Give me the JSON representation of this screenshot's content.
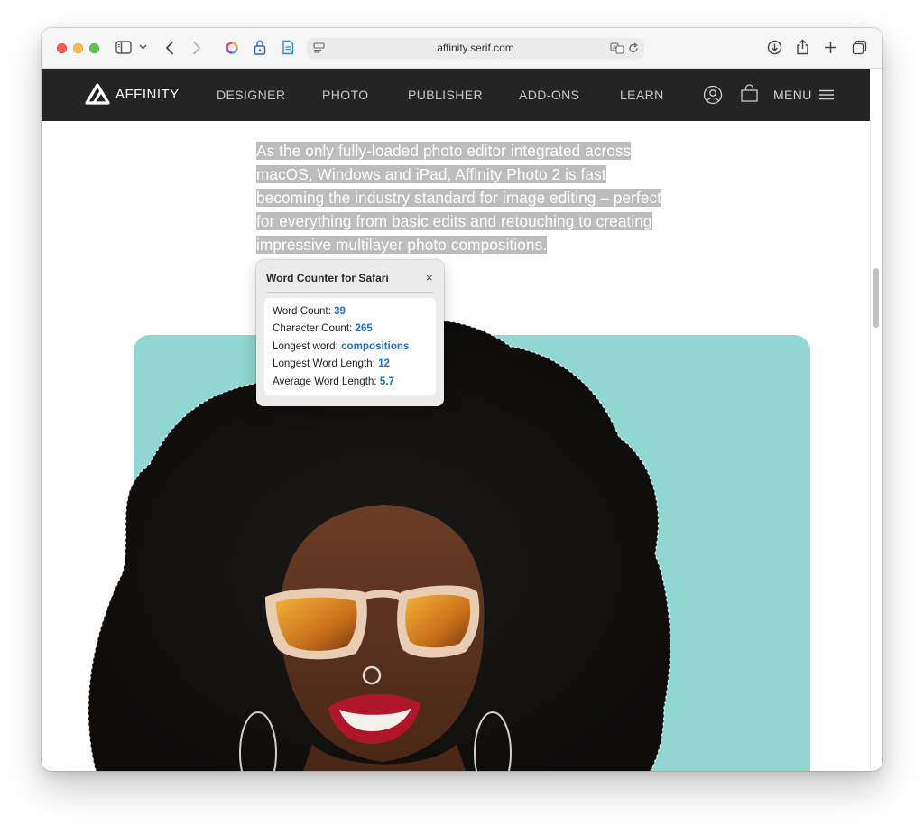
{
  "browser": {
    "url": "affinity.serif.com"
  },
  "site": {
    "logo_text": "AFFINITY",
    "nav": [
      "DESIGNER",
      "PHOTO",
      "PUBLISHER",
      "ADD-ONS",
      "LEARN"
    ],
    "menu_label": "MENU"
  },
  "content": {
    "selected_text": "As the only fully-loaded photo editor integrated across macOS, Windows and iPad, Affinity Photo 2 is fast becoming the industry standard for image editing – perfect for everything from basic edits and retouching to creating impressive multilayer photo compositions."
  },
  "popup": {
    "title": "Word Counter for Safari",
    "close_glyph": "×",
    "stats": [
      {
        "label": "Word Count:",
        "value": "39"
      },
      {
        "label": "Character Count:",
        "value": "265"
      },
      {
        "label": "Longest word:",
        "value": "compositions"
      },
      {
        "label": "Longest Word Length:",
        "value": "12"
      },
      {
        "label": "Average Word Length:",
        "value": "5.7"
      }
    ]
  },
  "colors": {
    "nav_bg": "#242424",
    "selection": "#bdbdbd",
    "stat_value": "#1a73c8",
    "hero_bg": "#8fd7d0"
  }
}
